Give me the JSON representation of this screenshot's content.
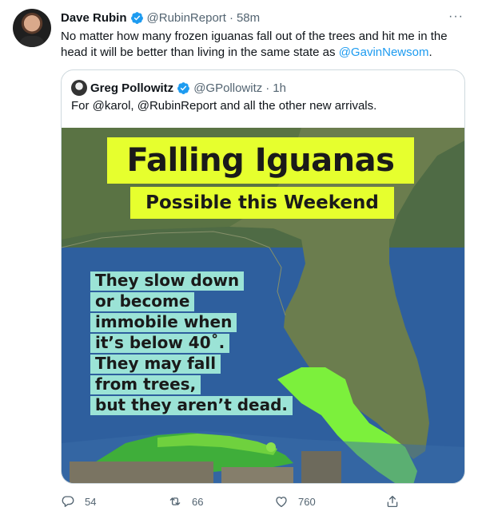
{
  "tweet": {
    "author_name": "Dave Rubin",
    "author_handle": "@RubinReport",
    "separator": "·",
    "time": "58m",
    "more_label": "···",
    "text_before_mention": "No matter how many frozen iguanas fall out of the trees and hit me in the head it will be better than living in the same state as ",
    "text_mention": "@GavinNewsom",
    "text_after_mention": "."
  },
  "quote": {
    "author_name": "Greg Pollowitz",
    "author_handle": "@GPollowitz",
    "separator": "·",
    "time": "1h",
    "text": "For @karol, @RubinReport and all the other new arrivals.",
    "image": {
      "title": "Falling Iguanas",
      "subtitle": "Possible this Weekend",
      "info_lines": [
        "They slow down",
        "or become",
        "immobile when",
        "it’s below 40˚.",
        "They may fall",
        "from trees,",
        "but they aren’t dead."
      ]
    }
  },
  "actions": {
    "reply_count": "54",
    "retweet_count": "66",
    "like_count": "760"
  },
  "colors": {
    "accent": "#1d9bf0",
    "secondary_text": "#536471",
    "border": "#cfd9de",
    "highlight_yellow": "#e6ff2e",
    "highlight_teal": "#9be3d6",
    "region_green": "#7cf03c"
  },
  "icons": [
    "verified-badge-icon",
    "more-icon",
    "reply-icon",
    "retweet-icon",
    "like-icon",
    "share-icon"
  ]
}
